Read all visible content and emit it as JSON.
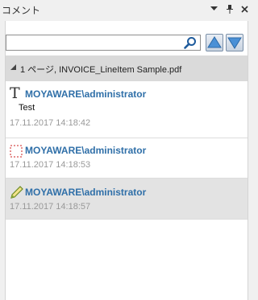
{
  "panel": {
    "title": "コメント",
    "controls": {
      "menu_icon": "dropdown-arrow",
      "pin_icon": "pin",
      "close_icon": "close"
    }
  },
  "search": {
    "value": "",
    "placeholder": "",
    "icon": "magnifier"
  },
  "nav": {
    "prev_icon": "triangle-up",
    "next_icon": "triangle-down"
  },
  "group": {
    "label": "1 ページ, INVOICE_LineItem Sample.pdf",
    "expanded": true
  },
  "comments": [
    {
      "icon": "text-T",
      "author": "MOYAWARE\\administrator",
      "text": "Test",
      "time": "17.11.2017 14:18:42",
      "selected": false
    },
    {
      "icon": "dashed-rectangle",
      "author": "MOYAWARE\\administrator",
      "text": "",
      "time": "17.11.2017 14:18:53",
      "selected": false
    },
    {
      "icon": "pencil",
      "author": "MOYAWARE\\administrator",
      "text": "",
      "time": "17.11.2017 14:18:57",
      "selected": true
    }
  ],
  "colors": {
    "author": "#2f6fa8",
    "timestamp": "#999999",
    "group_bg": "#dadada",
    "selected_bg": "#e3e3e3"
  }
}
